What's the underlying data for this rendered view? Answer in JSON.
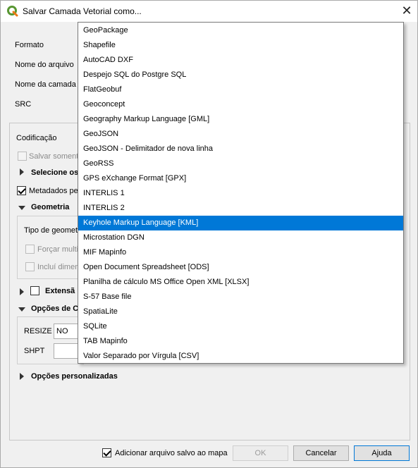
{
  "window": {
    "title": "Salvar Camada Vetorial como...",
    "close_symbol": "✕"
  },
  "form": {
    "format_label": "Formato",
    "filename_label": "Nome do arquivo",
    "layer_name_label": "Nome da camada",
    "crs_label": "SRC"
  },
  "group": {
    "encoding_label": "Codificação",
    "save_only_selected": "Salvar somente",
    "select_fields": "Selecione os",
    "metadata": "Metadados pe",
    "geometry": "Geometria",
    "geometry_type": "Tipo de geometr",
    "force_multi": "Forçar multi",
    "include_dim": "Incluí dimen",
    "extent": "Extensã",
    "layer_options": "Opções de C",
    "resize_label": "RESIZE",
    "resize_value": "NO",
    "shpt_label": "SHPT",
    "custom_options": "Opções personalizadas"
  },
  "footer": {
    "add_to_map": "Adicionar arquivo salvo ao mapa",
    "ok": "OK",
    "cancel": "Cancelar",
    "help": "Ajuda"
  },
  "dropdown": {
    "selected_index": 13,
    "items": [
      "GeoPackage",
      "Shapefile",
      "AutoCAD DXF",
      "Despejo SQL do Postgre SQL",
      "FlatGeobuf",
      "Geoconcept",
      "Geography Markup Language [GML]",
      "GeoJSON",
      "GeoJSON - Delimitador de nova linha",
      "GeoRSS",
      "GPS eXchange Format [GPX]",
      "INTERLIS 1",
      "INTERLIS 2",
      "Keyhole Markup Language [KML]",
      "Microstation DGN",
      "MIF Mapinfo",
      "Open Document Spreadsheet [ODS]",
      "Planilha de cálculo MS Office Open XML [XLSX]",
      "S-57 Base file",
      "SpatiaLite",
      "SQLite",
      "TAB Mapinfo",
      "Valor Separado por Vírgula [CSV]"
    ]
  },
  "colors": {
    "accent": "#0078d7",
    "qgis_green": "#589632"
  },
  "icons": {
    "app": "qgis-logo-icon",
    "close": "close-icon"
  }
}
